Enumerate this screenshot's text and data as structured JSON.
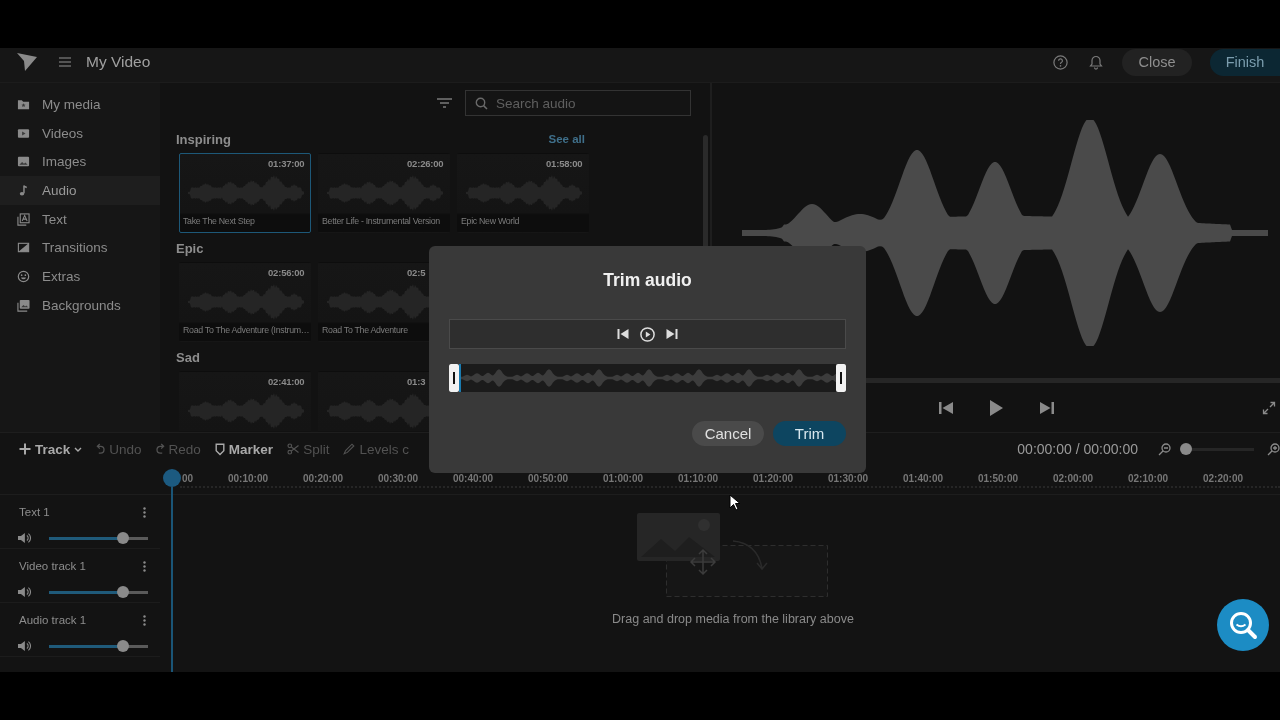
{
  "header": {
    "title": "My Video",
    "buttons": [
      {
        "label": "Close",
        "kind": "secondary"
      },
      {
        "label": "Finish",
        "kind": "primary"
      }
    ]
  },
  "sidebar": {
    "items": [
      {
        "label": "My media",
        "selected": false
      },
      {
        "label": "Videos",
        "selected": false
      },
      {
        "label": "Images",
        "selected": false
      },
      {
        "label": "Audio",
        "selected": true
      },
      {
        "label": "Text",
        "selected": false
      },
      {
        "label": "Transitions",
        "selected": false
      },
      {
        "label": "Extras",
        "selected": false
      },
      {
        "label": "Backgrounds",
        "selected": false
      }
    ]
  },
  "library": {
    "search": {
      "placeholder": "Search audio"
    },
    "sections": [
      {
        "title": "Inspiring",
        "link": "See all",
        "cards": [
          {
            "duration": "01:37:00",
            "title": "Take The Next Step",
            "selected": true
          },
          {
            "duration": "02:26:00",
            "title": "Better Life - Instrumental Version",
            "selected": false
          },
          {
            "duration": "01:58:00",
            "title": "Epic New World",
            "selected": false
          }
        ]
      },
      {
        "title": "Epic",
        "cards": [
          {
            "duration": "02:56:00",
            "title": "Road To The Adventure (Instrum…",
            "selected": false
          },
          {
            "duration": "02:5",
            "title": "Road To The Adventure",
            "selected": false
          }
        ]
      },
      {
        "title": "Sad",
        "cards": [
          {
            "duration": "02:41:00",
            "selected": false
          },
          {
            "duration": "01:3",
            "selected": false
          }
        ]
      }
    ]
  },
  "timeline": {
    "toolbar": [
      {
        "label": "Track",
        "disabled": false
      },
      {
        "label": "Undo",
        "disabled": true
      },
      {
        "label": "Redo",
        "disabled": true
      },
      {
        "label": "Marker",
        "disabled": false
      },
      {
        "label": "Split",
        "disabled": true
      },
      {
        "label": "Levels c",
        "disabled": true
      }
    ],
    "timecode": "00:00:00 / 00:00:00",
    "zoom": {
      "level": 0
    },
    "ruler": [
      "00",
      "00:10:00",
      "00:20:00",
      "00:30:00",
      "00:40:00",
      "00:50:00",
      "01:00:00",
      "01:10:00",
      "01:20:00",
      "01:30:00",
      "01:40:00",
      "01:50:00",
      "02:00:00",
      "02:10:00",
      "02:20:00"
    ],
    "tracks": [
      {
        "name": "Text 1",
        "level": 0.75
      },
      {
        "name": "Video track 1",
        "level": 0.75
      },
      {
        "name": "Audio track 1",
        "level": 0.75
      }
    ],
    "empty_hint": "Drag and drop media from the library above"
  },
  "dialog": {
    "title": "Trim audio",
    "buttons": [
      {
        "label": "Cancel",
        "kind": "secondary"
      },
      {
        "label": "Trim",
        "kind": "primary"
      }
    ]
  }
}
